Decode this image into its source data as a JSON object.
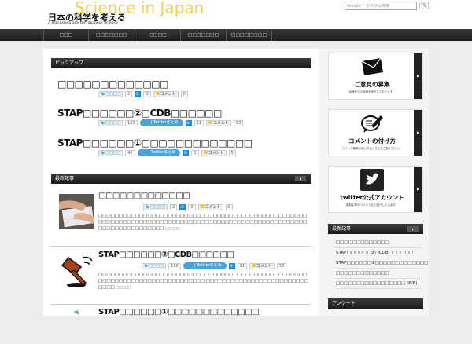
{
  "header": {
    "logo_bg": "Science in Japan",
    "site_title": "日本の科学を考える",
    "tagline": "A Discussion Site for Japanese Science",
    "search_placeholder": "Google™ カスタム検索",
    "search_button": "🔍"
  },
  "nav": [
    "□□□",
    "□□□□□□□",
    "□□□□",
    "□□□□□□□",
    "□□□□□□□□"
  ],
  "pickup": {
    "heading": "ピックアップ",
    "items": [
      {
        "title": "□□□□□□□□□□□□□",
        "tweet_label": "□□□□",
        "tweets": "2",
        "hatena": "0",
        "comment_label": "コメント",
        "comments": "0",
        "twitter_summary": ""
      },
      {
        "title": "STAP□□□□□□②□CDB□□□□□□",
        "tweet_label": "□□□□",
        "tweets": "150",
        "hatena": "11",
        "comment_label": "コメント",
        "comments": "53",
        "twitter_summary": "Twitterまとめ"
      },
      {
        "title": "STAP□□□□□□①□□□□□□□□□□□□□",
        "tweet_label": "□□□□",
        "tweets": "40",
        "hatena": "1",
        "comment_label": "コメント",
        "comments": "5",
        "twitter_summary": "Twitterまとめ"
      }
    ]
  },
  "latest": {
    "heading": "最新記事",
    "more": "▸",
    "items": [
      {
        "title": "□□□□□□□□□□□□□",
        "tweet_label": "□□□□",
        "tweets": "2",
        "hatena": "0",
        "comment_label": "コメント",
        "comments": "0",
        "excerpt": "□□□□□□□□□□□□□□□□□□□□□□□□□□□□□□□□□□□□□□□□□□□□□□□□□□□□□□□□□□□□□□□□□□□□□□□□□□□□□□□□□□□□□□□□□□□□□□□□□□□□□□□□□□□□□□□□□□□□□□",
        "more": "□□□□□",
        "twitter_summary": ""
      },
      {
        "title": "STAP□□□□□□②□CDB□□□□□□",
        "tweet_label": "□□□□",
        "tweets": "150",
        "hatena": "11",
        "comment_label": "コメント",
        "comments": "53",
        "excerpt": "□□□□□□□□□□□□□□□□□□□□□□□□□□□□□□□□□□□□□□□□□□□□□□□□□□□□□□□□□□□□□□□□□□□□□□□□□□□□□ □□□□□□□□□□□□□□□□□□□□□□□□□□□□□",
        "more": "□□□□□",
        "twitter_summary": "Twitterまとめ"
      },
      {
        "title": "STAP□□□□□□①□□□□□□□□□□□□□"
      }
    ]
  },
  "sidebar": {
    "banners": [
      {
        "title": "ご意見の募集",
        "sub": "皆様からの投稿お待ちしております。"
      },
      {
        "title": "コメントの付け方",
        "sub": "コメント機能の使い方はこちらをご覧ください。"
      },
      {
        "title": "twitter公式アカウント",
        "sub": "最新記事やコメントなど紹介しています。"
      }
    ],
    "recent_heading": "最新記事",
    "recent_more": "▸",
    "recent": [
      "□□□□□□□□□□□□□",
      "STAP□□□□□□②□CDB□□□□□□",
      "STAP□□□□□□①□□□□□□□□□□□□□",
      "□□□□□□□□□□□□□",
      "□□□□□□□□□□□□□□□□□ (6/6)"
    ],
    "survey_heading": "アンケート"
  }
}
